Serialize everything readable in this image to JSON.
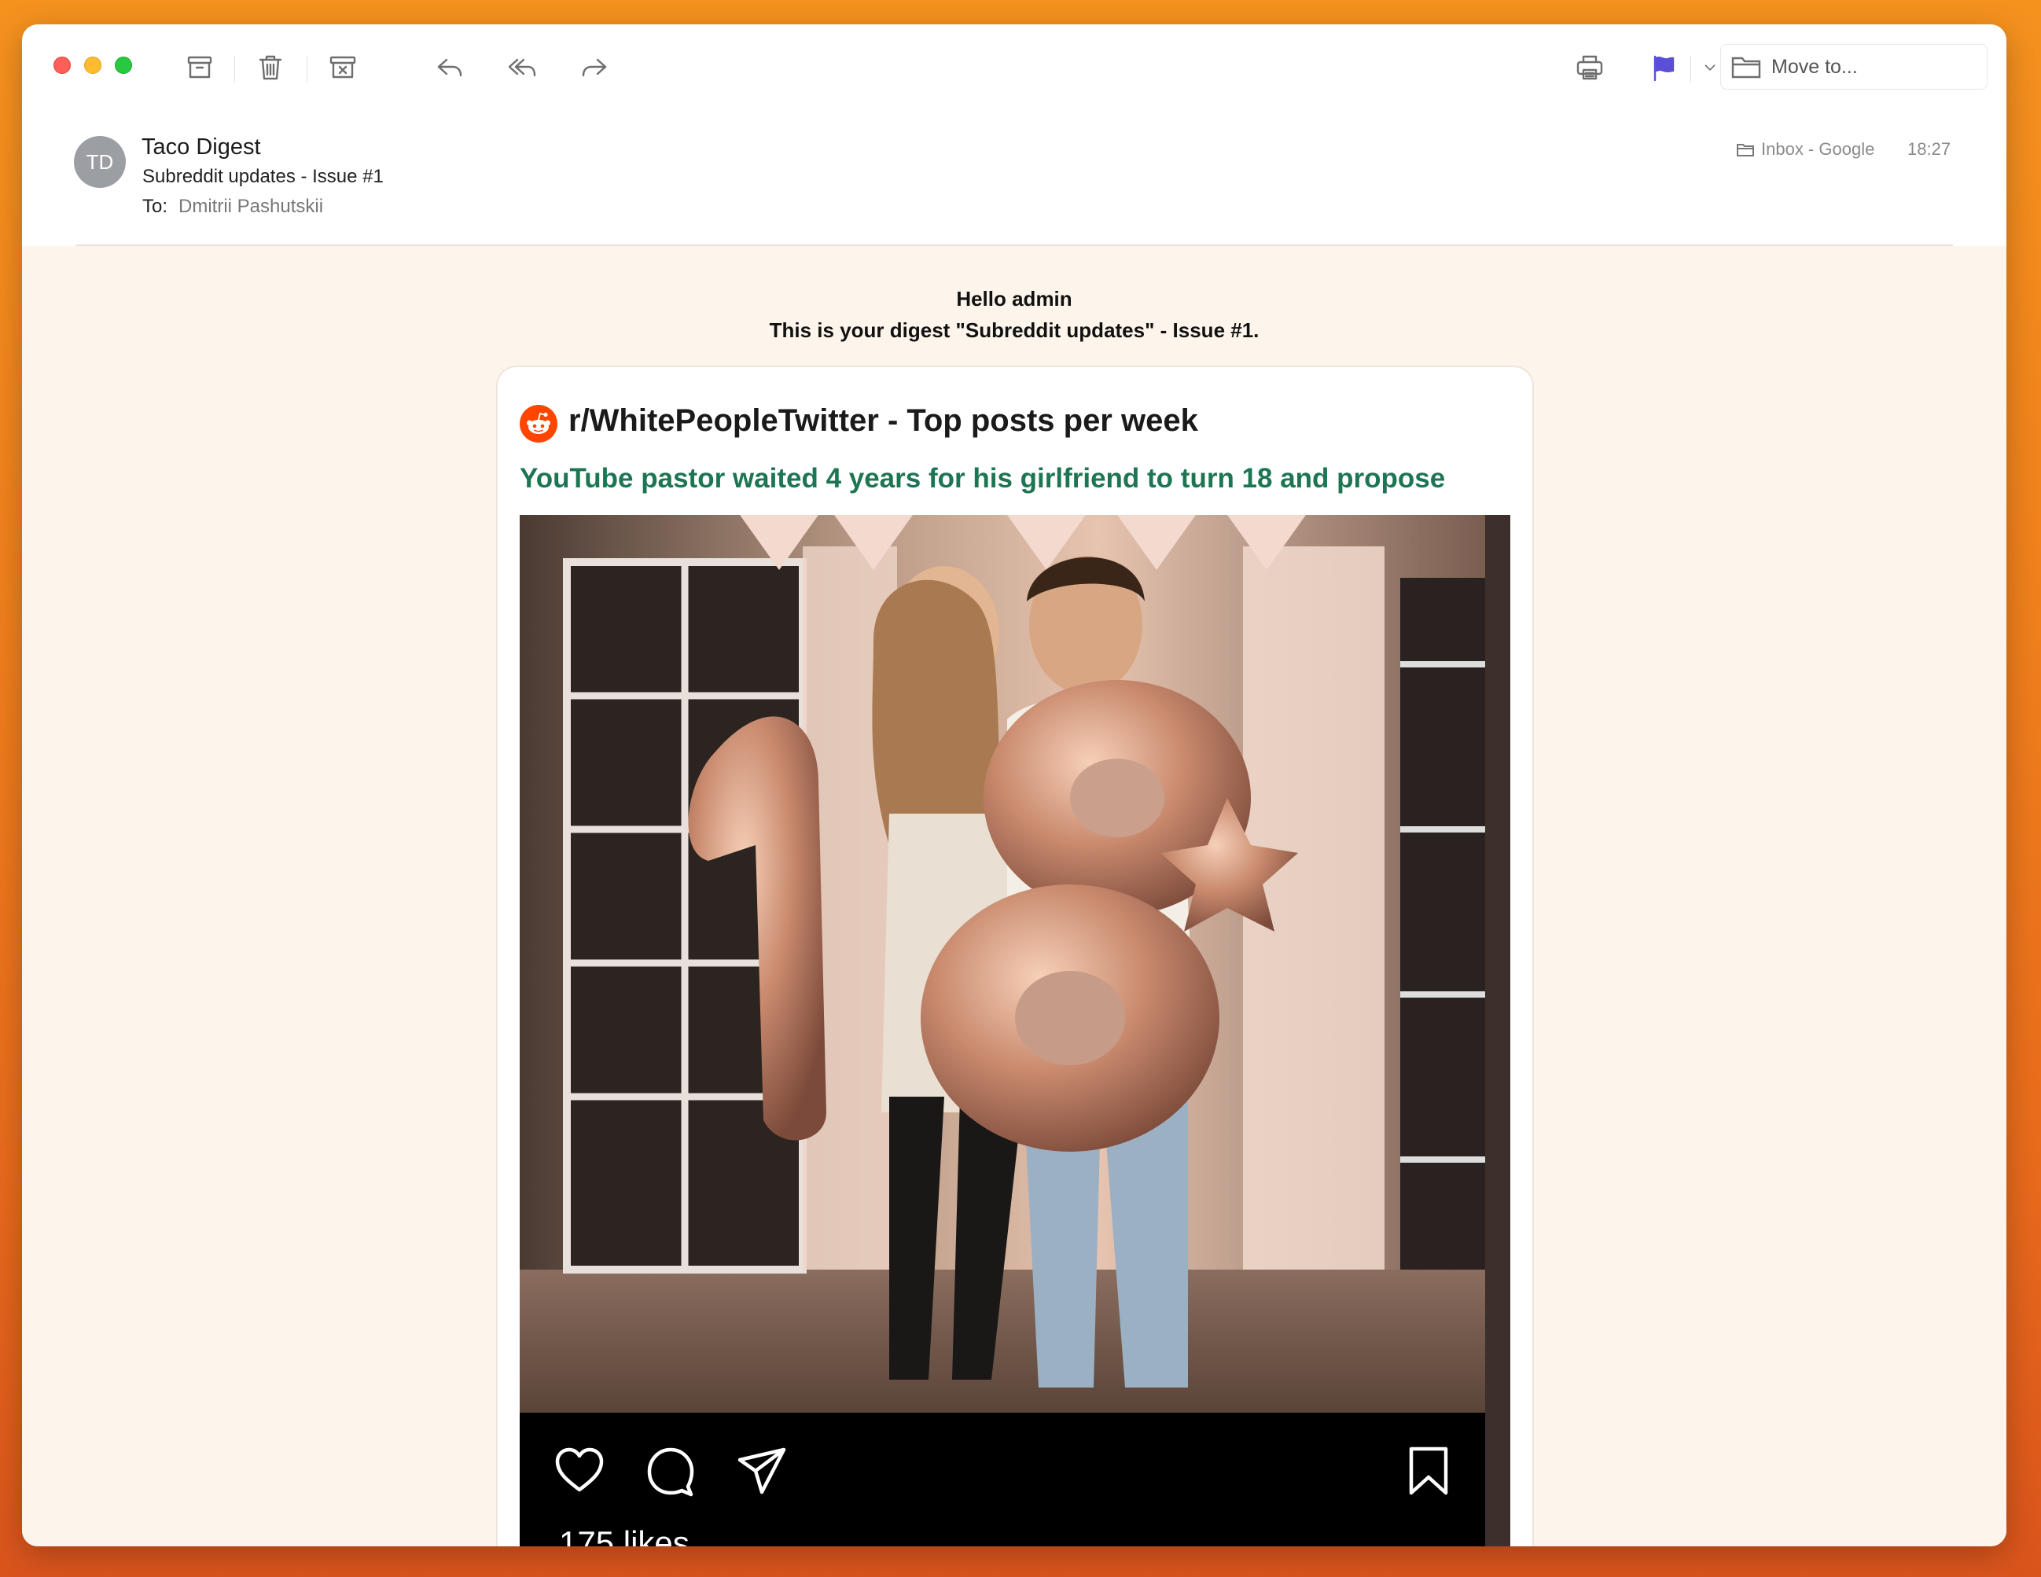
{
  "toolbar": {
    "move_to_label": "Move to..."
  },
  "message": {
    "avatar_initials": "TD",
    "sender": "Taco Digest",
    "subject": "Subreddit updates - Issue #1",
    "to_label": "To:",
    "to_name": "Dmitrii Pashutskii",
    "mailbox": "Inbox - Google",
    "time": "18:27"
  },
  "body": {
    "greeting": "Hello admin",
    "digest_line": "This is your digest \"Subreddit updates\" - Issue #1.",
    "card_title": "r/WhitePeopleTwitter - Top posts per week",
    "post_title": "YouTube pastor waited 4 years for his girlfriend to turn 18 and propose",
    "instagram": {
      "likes": "175 likes"
    }
  },
  "colors": {
    "flag": "#5a4fd6",
    "post_title": "#1d7553",
    "reddit_orange": "#ff4500",
    "body_bg": "#fdf5ec"
  },
  "icons": [
    "archive-icon",
    "trash-icon",
    "junk-icon",
    "reply-icon",
    "reply-all-icon",
    "forward-icon",
    "print-icon",
    "flag-icon",
    "chevron-down-icon",
    "folder-icon",
    "reddit-icon",
    "heart-icon",
    "comment-icon",
    "share-icon",
    "bookmark-icon"
  ]
}
